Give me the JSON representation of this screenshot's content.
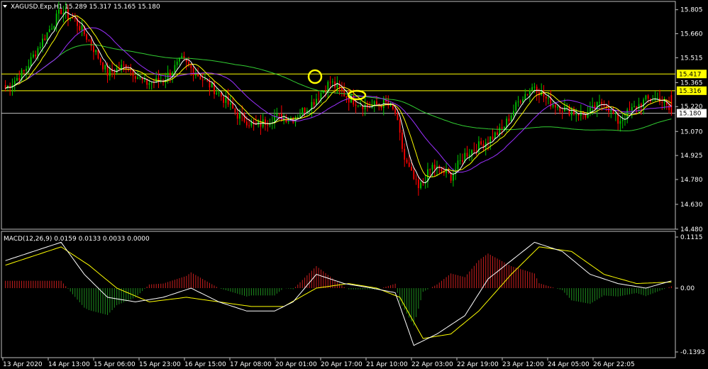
{
  "window": {
    "symbol_line": "XAGUSD.Exp,H1  15.289 15.317 15.165 15.180",
    "menu_icon": "triangle-down-icon"
  },
  "colors": {
    "background": "#000000",
    "frame": "#c0c0c0",
    "bull_candle": "#00c800",
    "bear_candle": "#ff0000",
    "ma_fast": "#ffffff",
    "ma_mid": "#ffff00",
    "ma_slow_purple": "#9b30ff",
    "ma_long_green": "#32cd32",
    "resistance_line": "#ffff00",
    "bid_line": "#c0c0c0",
    "macd_hist_pos": "#c81e1e",
    "macd_hist_neg": "#1e8c1e",
    "macd_main": "#ffffff",
    "macd_signal": "#ffff00",
    "annotation": "#ffff00"
  },
  "price_panel": {
    "y_ticks": [
      "15.805",
      "15.660",
      "15.515",
      "15.365",
      "15.220",
      "15.070",
      "14.925",
      "14.780",
      "14.630",
      "14.480"
    ],
    "ylim": [
      14.48,
      15.855
    ],
    "resistance_labels": [
      "15.417",
      "15.316"
    ],
    "bid_label": "15.180",
    "annotations": [
      "circle-highlight",
      "ellipse-highlight"
    ]
  },
  "macd_panel": {
    "title": "MACD(12,26,9) 0.0159 0.0133 0.0033 0.0000",
    "y_ticks": [
      "0.1115",
      "0.00",
      "-0.1393"
    ],
    "ylim": [
      -0.1393,
      0.1115
    ]
  },
  "x_axis": {
    "ticks": [
      "13 Apr 2020",
      "14 Apr 13:00",
      "15 Apr 06:00",
      "15 Apr 23:00",
      "16 Apr 15:00",
      "17 Apr 08:00",
      "20 Apr 01:00",
      "20 Apr 17:00",
      "21 Apr 10:00",
      "22 Apr 03:00",
      "22 Apr 19:00",
      "23 Apr 12:00",
      "24 Apr 05:00",
      "26 Apr 22:05"
    ]
  },
  "chart_data": {
    "type": "candlestick",
    "symbol": "XAGUSD.Exp",
    "timeframe": "H1",
    "last_ohlc": {
      "open": 15.289,
      "high": 15.317,
      "low": 15.165,
      "close": 15.18
    },
    "horizontal_levels": [
      15.417,
      15.316
    ],
    "bid": 15.18,
    "close_path": [
      [
        0,
        15.33
      ],
      [
        8,
        15.43
      ],
      [
        16,
        15.62
      ],
      [
        24,
        15.8
      ],
      [
        30,
        15.74
      ],
      [
        36,
        15.62
      ],
      [
        44,
        15.42
      ],
      [
        52,
        15.47
      ],
      [
        60,
        15.36
      ],
      [
        68,
        15.38
      ],
      [
        76,
        15.5
      ],
      [
        84,
        15.4
      ],
      [
        92,
        15.3
      ],
      [
        100,
        15.17
      ],
      [
        108,
        15.1
      ],
      [
        116,
        15.16
      ],
      [
        124,
        15.15
      ],
      [
        132,
        15.24
      ],
      [
        140,
        15.37
      ],
      [
        148,
        15.27
      ],
      [
        156,
        15.22
      ],
      [
        164,
        15.24
      ],
      [
        168,
        15.18
      ],
      [
        172,
        14.9
      ],
      [
        178,
        14.72
      ],
      [
        184,
        14.86
      ],
      [
        192,
        14.8
      ],
      [
        198,
        14.93
      ],
      [
        206,
        15.0
      ],
      [
        214,
        15.08
      ],
      [
        222,
        15.27
      ],
      [
        228,
        15.35
      ],
      [
        234,
        15.25
      ],
      [
        242,
        15.2
      ],
      [
        250,
        15.17
      ],
      [
        258,
        15.25
      ],
      [
        264,
        15.13
      ],
      [
        270,
        15.2
      ],
      [
        276,
        15.26
      ],
      [
        282,
        15.27
      ],
      [
        287,
        15.18
      ]
    ],
    "macd_main_path": [
      [
        0,
        0.06
      ],
      [
        12,
        0.08
      ],
      [
        24,
        0.1
      ],
      [
        34,
        0.03
      ],
      [
        44,
        -0.02
      ],
      [
        56,
        -0.03
      ],
      [
        68,
        -0.02
      ],
      [
        80,
        0.0
      ],
      [
        92,
        -0.03
      ],
      [
        104,
        -0.05
      ],
      [
        116,
        -0.05
      ],
      [
        124,
        -0.03
      ],
      [
        134,
        0.03
      ],
      [
        146,
        0.01
      ],
      [
        158,
        0.0
      ],
      [
        168,
        -0.01
      ],
      [
        176,
        -0.125
      ],
      [
        186,
        -0.1
      ],
      [
        198,
        -0.06
      ],
      [
        208,
        0.02
      ],
      [
        218,
        0.06
      ],
      [
        228,
        0.1
      ],
      [
        240,
        0.08
      ],
      [
        252,
        0.03
      ],
      [
        264,
        0.01
      ],
      [
        276,
        0.0
      ],
      [
        287,
        0.0159
      ]
    ],
    "macd_signal_path": [
      [
        0,
        0.05
      ],
      [
        12,
        0.07
      ],
      [
        24,
        0.09
      ],
      [
        36,
        0.05
      ],
      [
        48,
        0.0
      ],
      [
        62,
        -0.03
      ],
      [
        78,
        -0.02
      ],
      [
        92,
        -0.03
      ],
      [
        106,
        -0.04
      ],
      [
        120,
        -0.04
      ],
      [
        134,
        0.0
      ],
      [
        148,
        0.01
      ],
      [
        160,
        0.0
      ],
      [
        170,
        -0.02
      ],
      [
        180,
        -0.11
      ],
      [
        192,
        -0.1
      ],
      [
        204,
        -0.05
      ],
      [
        218,
        0.03
      ],
      [
        230,
        0.09
      ],
      [
        244,
        0.08
      ],
      [
        258,
        0.03
      ],
      [
        272,
        0.01
      ],
      [
        287,
        0.0133
      ]
    ]
  }
}
